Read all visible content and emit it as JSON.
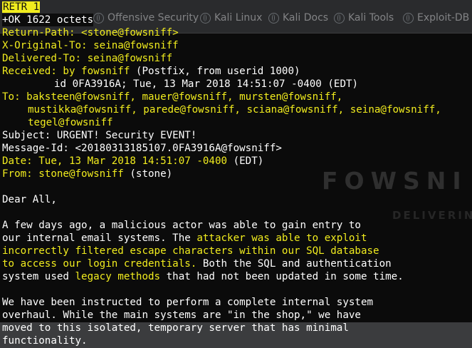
{
  "browser": {
    "bookmarks": [
      {
        "label": "Offensive Security",
        "icon": "globe-icon"
      },
      {
        "label": "Kali Linux",
        "icon": "globe-icon"
      },
      {
        "label": "Kali Docs",
        "icon": "globe-icon"
      },
      {
        "label": "Kali Tools",
        "icon": "globe-icon"
      },
      {
        "label": "Exploit-DB",
        "icon": "globe-icon"
      }
    ],
    "watermark_title": "FOWSNI",
    "watermark_sub": "DELIVERIN"
  },
  "terminal": {
    "colors": {
      "highlight": "#f1ec1e",
      "text": "#ffffff",
      "background": "#0b0b0b"
    },
    "command": "RETR 1",
    "response": "+OK 1622 octets",
    "return_path": "Return-Path: <stone@fowsniff>",
    "x_original_to": "X-Original-To: seina@fowsniff",
    "delivered_to": "Delivered-To: seina@fowsniff",
    "received_a": "Received: by fowsniff",
    "received_b": " (Postfix, from userid 1000)",
    "received_line2": "id 0FA3916A; Tue, 13 Mar 2018 14:51:07 -0400 (EDT)",
    "to_line1": "To: baksteen@fowsniff, mauer@fowsniff, mursten@fowsniff,",
    "to_line2": "mustikka@fowsniff, parede@fowsniff, sciana@fowsniff, seina@fowsniff,",
    "to_line3": "tegel@fowsniff",
    "subject": "Subject: URGENT! Security EVENT!",
    "message_id": "Message-Id: <20180313185107.0FA3916A@fowsniff>",
    "date_a": "Date: Tue, 13 Mar 2018 14:51:07 -0400",
    "date_b": " (EDT)",
    "from_a": "From: stone@fowsniff",
    "from_b": " (stone)",
    "greeting": "Dear All,",
    "p1_l1": "A few days ago, a malicious actor was able to gain entry to",
    "p1_l2a": "our internal email systems. The ",
    "p1_l2b": "attacker was able to exploit",
    "p1_l3": "incorrectly filtered escape characters within our SQL database",
    "p1_l4a": "to access our login credentials.",
    "p1_l4b": " Both the SQL and authentication",
    "p1_l5a": "system used ",
    "p1_l5b": "legacy methods",
    "p1_l5c": " that had not been updated in some time.",
    "p2_l1": "We have been instructed to perform a complete internal system",
    "p2_l2": "overhaul. While the main systems are \"in the shop,\" we have",
    "p2_l3": "moved to this isolated, temporary server that has minimal",
    "p2_l4": "functionality."
  }
}
